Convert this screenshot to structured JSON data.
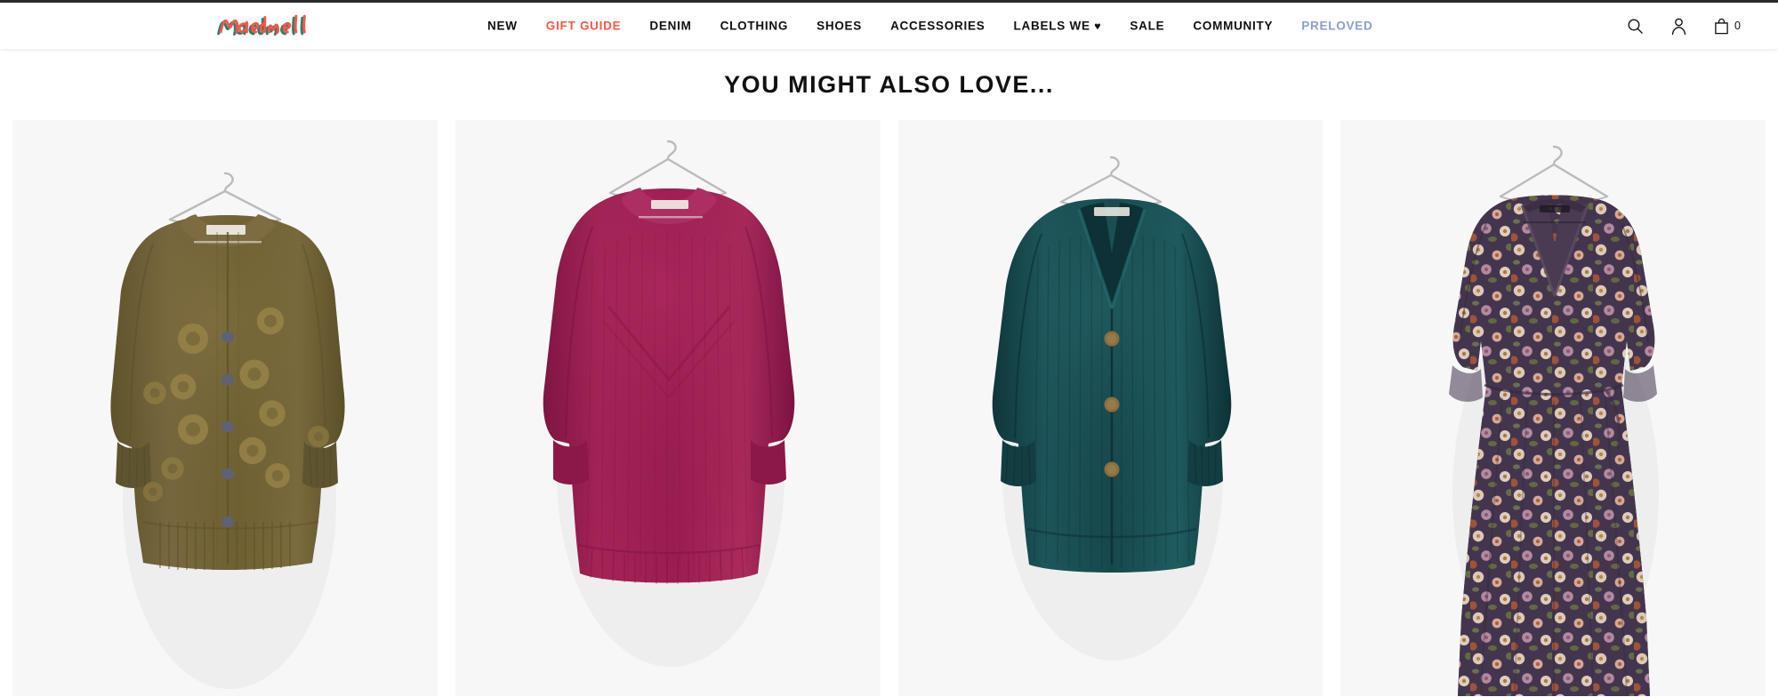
{
  "brand": {
    "name": "Madewell",
    "logo_colors": {
      "coral": "#f4564a",
      "teal": "#1f7a63"
    }
  },
  "nav": {
    "items": [
      {
        "label": "NEW",
        "style": "default"
      },
      {
        "label": "GIFT GUIDE",
        "style": "accent-gift"
      },
      {
        "label": "DENIM",
        "style": "default"
      },
      {
        "label": "CLOTHING",
        "style": "default"
      },
      {
        "label": "SHOES",
        "style": "default"
      },
      {
        "label": "ACCESSORIES",
        "style": "default"
      },
      {
        "label": "LABELS WE ",
        "style": "default",
        "heart": "♥"
      },
      {
        "label": "SALE",
        "style": "default"
      },
      {
        "label": "COMMUNITY",
        "style": "default"
      },
      {
        "label": "PRELOVED",
        "style": "accent-preloved"
      }
    ]
  },
  "utility": {
    "search_icon": "search-icon",
    "account_icon": "account-icon",
    "bag_icon": "shopping-bag-icon",
    "bag_count": "0"
  },
  "section": {
    "title": "YOU MIGHT ALSO LOVE..."
  },
  "products": [
    {
      "name": "olive-floral-embroidered-cardigan",
      "alt": "Olive green cardigan sweater with embroidered flowers on hanger",
      "garment_type": "cardigan",
      "colors": {
        "body": "#6f6132",
        "shadow": "#5c5129",
        "highlight": "#867445",
        "flower": "#958147",
        "button": "#5f6274"
      },
      "card_bg": "#f7f7f8"
    },
    {
      "name": "berry-pullover-sweater",
      "alt": "Berry magenta pullover sweater on hanger",
      "garment_type": "pullover",
      "colors": {
        "body": "#9c1d50",
        "shadow": "#7d1440",
        "highlight": "#b63064",
        "flower": "",
        "button": ""
      },
      "card_bg": "#f7f7f8"
    },
    {
      "name": "teal-chenille-cardigan",
      "alt": "Dark teal chenille cardigan with buttons on hanger",
      "garment_type": "cardigan",
      "colors": {
        "body": "#17484c",
        "shadow": "#0e3438",
        "highlight": "#236064",
        "flower": "",
        "button": "#8a6f3f"
      },
      "card_bg": "#f7f7f8"
    },
    {
      "name": "floral-wrap-dress",
      "alt": "Floral print wrap dress with V-neck on hanger",
      "garment_type": "dress",
      "colors": {
        "body": "#4a3a52",
        "shadow": "#372b3f",
        "highlight": "#c9a08c",
        "flower": "#f0dcc4",
        "button": "#b05a33"
      },
      "card_bg": "#f7f7f8"
    }
  ]
}
